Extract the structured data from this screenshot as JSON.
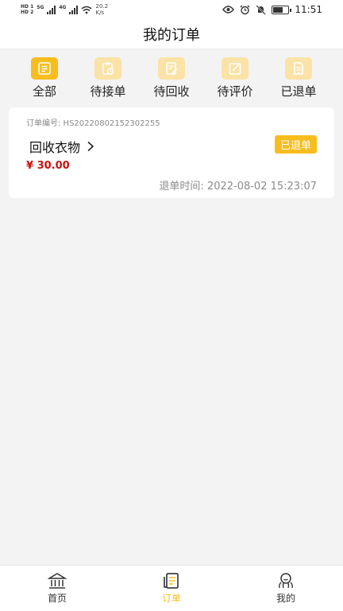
{
  "status_bar": {
    "hd1": "HD 1",
    "hd2": "HD 2",
    "net1": "5G",
    "net2": "4G",
    "speed_value": "20.2",
    "speed_unit": "K/s",
    "time": "11:51",
    "battery_icon": "battery-icon"
  },
  "header": {
    "title": "我的订单"
  },
  "tabs": [
    {
      "label": "全部",
      "icon": "list-icon",
      "active": true
    },
    {
      "label": "待接单",
      "icon": "clipboard-clock-icon"
    },
    {
      "label": "待回收",
      "icon": "document-edit-icon"
    },
    {
      "label": "待评价",
      "icon": "pencil-square-icon"
    },
    {
      "label": "已退单",
      "icon": "document-return-icon"
    }
  ],
  "order": {
    "number_label": "订单编号: HS20220802152302255",
    "title": "回收衣物",
    "status": "已退单",
    "price": "¥ 30.00",
    "refund_time": "退单时间: 2022-08-02 15:23:07"
  },
  "bottom_nav": [
    {
      "label": "首页",
      "icon": "home-icon"
    },
    {
      "label": "订单",
      "icon": "order-icon",
      "active": true
    },
    {
      "label": "我的",
      "icon": "profile-icon"
    }
  ],
  "colors": {
    "accent": "#f7bd1e",
    "accent_light": "#fbe3a8",
    "price_red": "#cc1111",
    "background": "#f3f3f3"
  }
}
